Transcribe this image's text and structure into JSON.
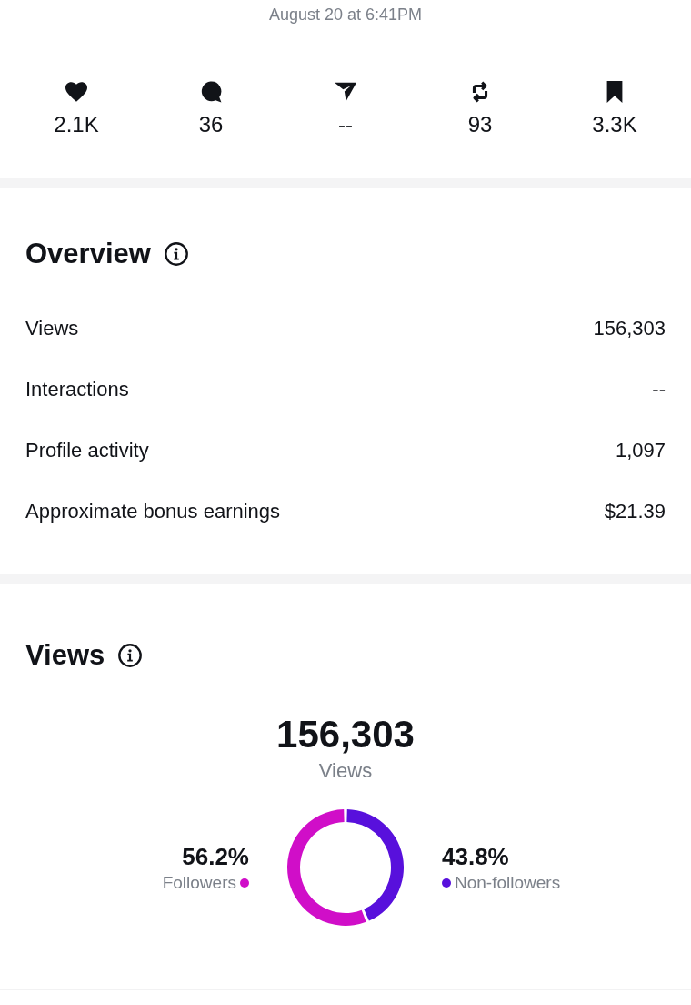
{
  "timestamp": "August 20 at 6:41PM",
  "stats": [
    {
      "kind": "heart",
      "value": "2.1K"
    },
    {
      "kind": "comment",
      "value": "36"
    },
    {
      "kind": "send",
      "value": "--"
    },
    {
      "kind": "repost",
      "value": "93"
    },
    {
      "kind": "bookmark",
      "value": "3.3K"
    }
  ],
  "overview": {
    "title": "Overview",
    "rows": [
      {
        "label": "Views",
        "value": "156,303"
      },
      {
        "label": "Interactions",
        "value": "--"
      },
      {
        "label": "Profile activity",
        "value": "1,097"
      },
      {
        "label": "Approximate bonus earnings",
        "value": "$21.39"
      }
    ]
  },
  "views": {
    "title": "Views",
    "total": "156,303",
    "total_label": "Views",
    "legend": [
      {
        "percent": "56.2%",
        "color": "#d00ec8"
      },
      {
        "percent": "43.8%",
        "color": "#5810dc"
      }
    ],
    "chart_data": {
      "type": "donut",
      "categories": [
        "Followers",
        "Non-followers"
      ],
      "values": [
        56.2,
        43.8
      ]
    }
  }
}
